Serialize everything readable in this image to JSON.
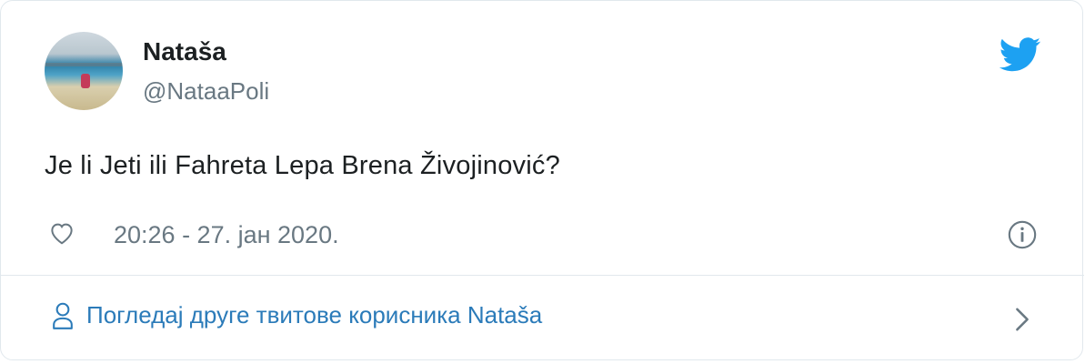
{
  "tweet": {
    "author_name": "Nataša",
    "author_handle": "@NataaPoli",
    "text": "Je li Jeti ili Fahreta Lepa Brena Živojinović?",
    "timestamp": "20:26 - 27. јан 2020."
  },
  "footer": {
    "more_tweets_label": "Погледај друге твитове корисника Nataša"
  },
  "icons": {
    "brand": "twitter-bird-icon",
    "like": "heart-icon",
    "info": "info-icon",
    "user": "user-icon",
    "chevron": "chevron-right-icon"
  },
  "colors": {
    "brand": "#1da1f2",
    "link": "#2b7bb9",
    "muted": "#697882",
    "text": "#1c2022",
    "border": "#e1e8ed"
  }
}
